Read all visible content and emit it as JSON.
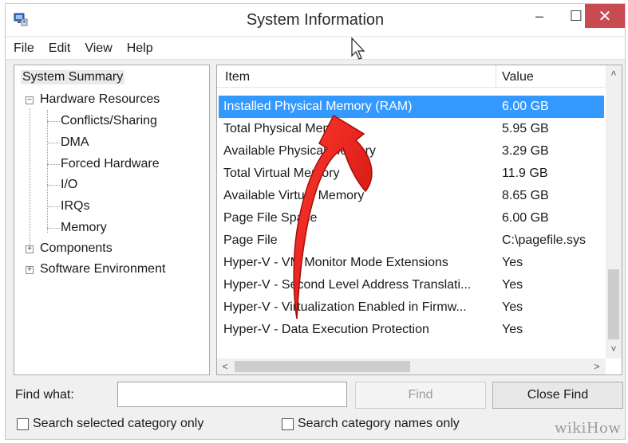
{
  "window": {
    "title": "System Information"
  },
  "controls": {
    "minimize": "–",
    "maximize": "☐",
    "close": "✕"
  },
  "menu": [
    "File",
    "Edit",
    "View",
    "Help"
  ],
  "tree": {
    "root": "System Summary",
    "hardware": "Hardware Resources",
    "hardware_children": [
      "Conflicts/Sharing",
      "DMA",
      "Forced Hardware",
      "I/O",
      "IRQs",
      "Memory"
    ],
    "components": "Components",
    "software": "Software Environment",
    "expander_expanded": "−",
    "expander_collapsed": "+"
  },
  "list": {
    "columns": [
      "Item",
      "Value"
    ],
    "rows": [
      {
        "item": "Installed Physical Memory (RAM)",
        "value": "6.00 GB",
        "selected": true
      },
      {
        "item": "Total Physical Memory",
        "value": "5.95 GB"
      },
      {
        "item": "Available Physical Memory",
        "value": "3.29 GB"
      },
      {
        "item": "Total Virtual Memory",
        "value": "11.9 GB"
      },
      {
        "item": "Available Virtual Memory",
        "value": "8.65 GB"
      },
      {
        "item": "Page File Space",
        "value": "6.00 GB"
      },
      {
        "item": "Page File",
        "value": "C:\\pagefile.sys"
      },
      {
        "item": "Hyper-V - VM Monitor Mode Extensions",
        "value": "Yes"
      },
      {
        "item": "Hyper-V - Second Level Address Translati...",
        "value": "Yes"
      },
      {
        "item": "Hyper-V - Virtualization Enabled in Firmw...",
        "value": "Yes"
      },
      {
        "item": "Hyper-V - Data Execution Protection",
        "value": "Yes"
      }
    ],
    "selected_color": "#3399ff",
    "scroll_up": "˄",
    "scroll_down": "˅",
    "scroll_left": "<",
    "scroll_right": ">"
  },
  "find": {
    "label": "Find what:",
    "value": "",
    "find_button": "Find",
    "close_find_button": "Close Find",
    "checkbox_selected": "Search selected category only",
    "checkbox_names": "Search category names only"
  },
  "watermark": "wikiHow",
  "accent": {
    "arrow": "#e0201c",
    "close_button": "#c74b50"
  }
}
